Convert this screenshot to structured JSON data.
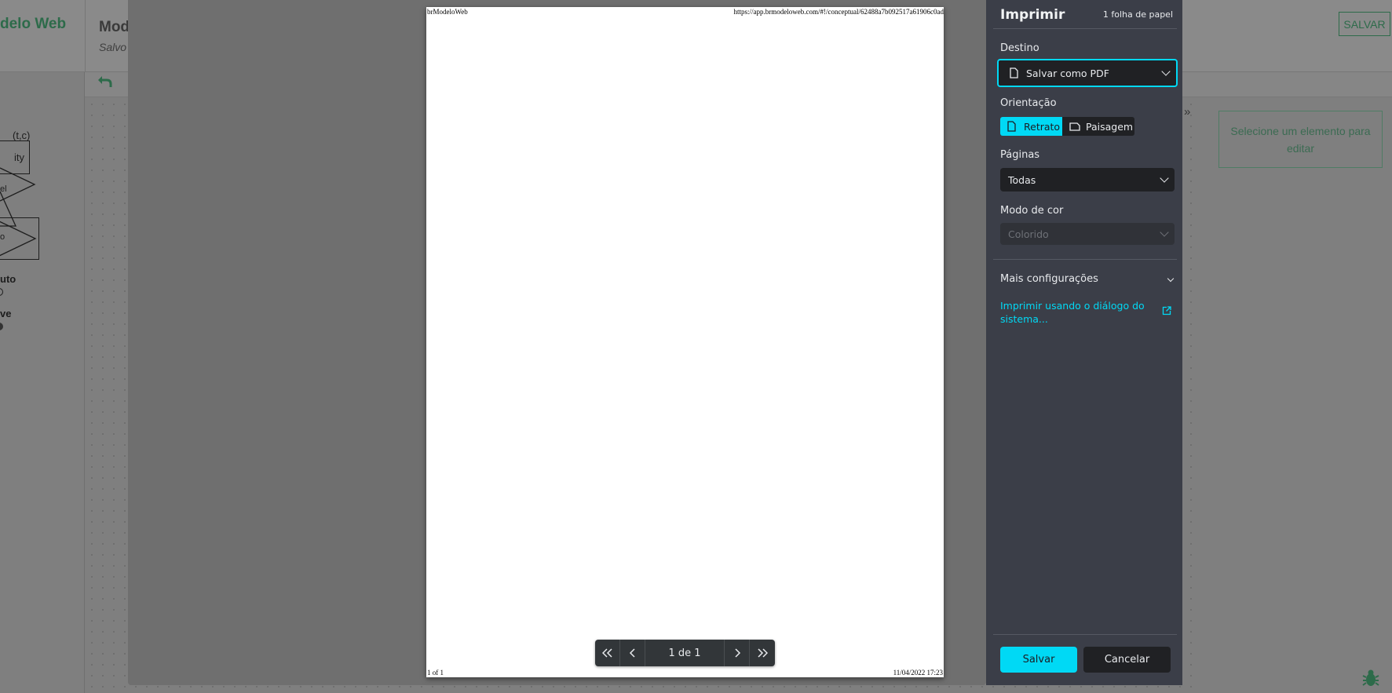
{
  "app": {
    "logo": "delo Web",
    "title": "Mod",
    "status": "Salvo",
    "save_label": "SALVAR",
    "palette": {
      "entity": "ity",
      "triangle_label": "(t,c)",
      "rel1": "el",
      "rel2": "o",
      "attr": "uto",
      "key": "ve"
    },
    "right_panel_hint": "Selecione um elemento para editar",
    "collapse_glyph": "»"
  },
  "preview": {
    "header_left": "brModeloWeb",
    "header_right": "https://app.brmodeloweb.com/#!/conceptual/62488a7b092517a61906c0ad",
    "footer_left": "1 of 1",
    "footer_right": "11/04/2022 17:23",
    "page_indicator": "1 de 1"
  },
  "print": {
    "title": "Imprimir",
    "sheets": "1 folha de papel",
    "destination_label": "Destino",
    "destination_value": "Salvar como PDF",
    "orientation_label": "Orientação",
    "orientation_portrait": "Retrato",
    "orientation_landscape": "Paisagem",
    "pages_label": "Páginas",
    "pages_value": "Todas",
    "color_label": "Modo de cor",
    "color_value": "Colorido",
    "more_settings": "Mais configurações",
    "system_dialog_link": "Imprimir usando o diálogo do sistema...",
    "save_button": "Salvar",
    "cancel_button": "Cancelar"
  },
  "colors": {
    "accent": "#00d9f5",
    "panel_bg": "#3b3e48",
    "brand_green": "#2d6b4a"
  }
}
